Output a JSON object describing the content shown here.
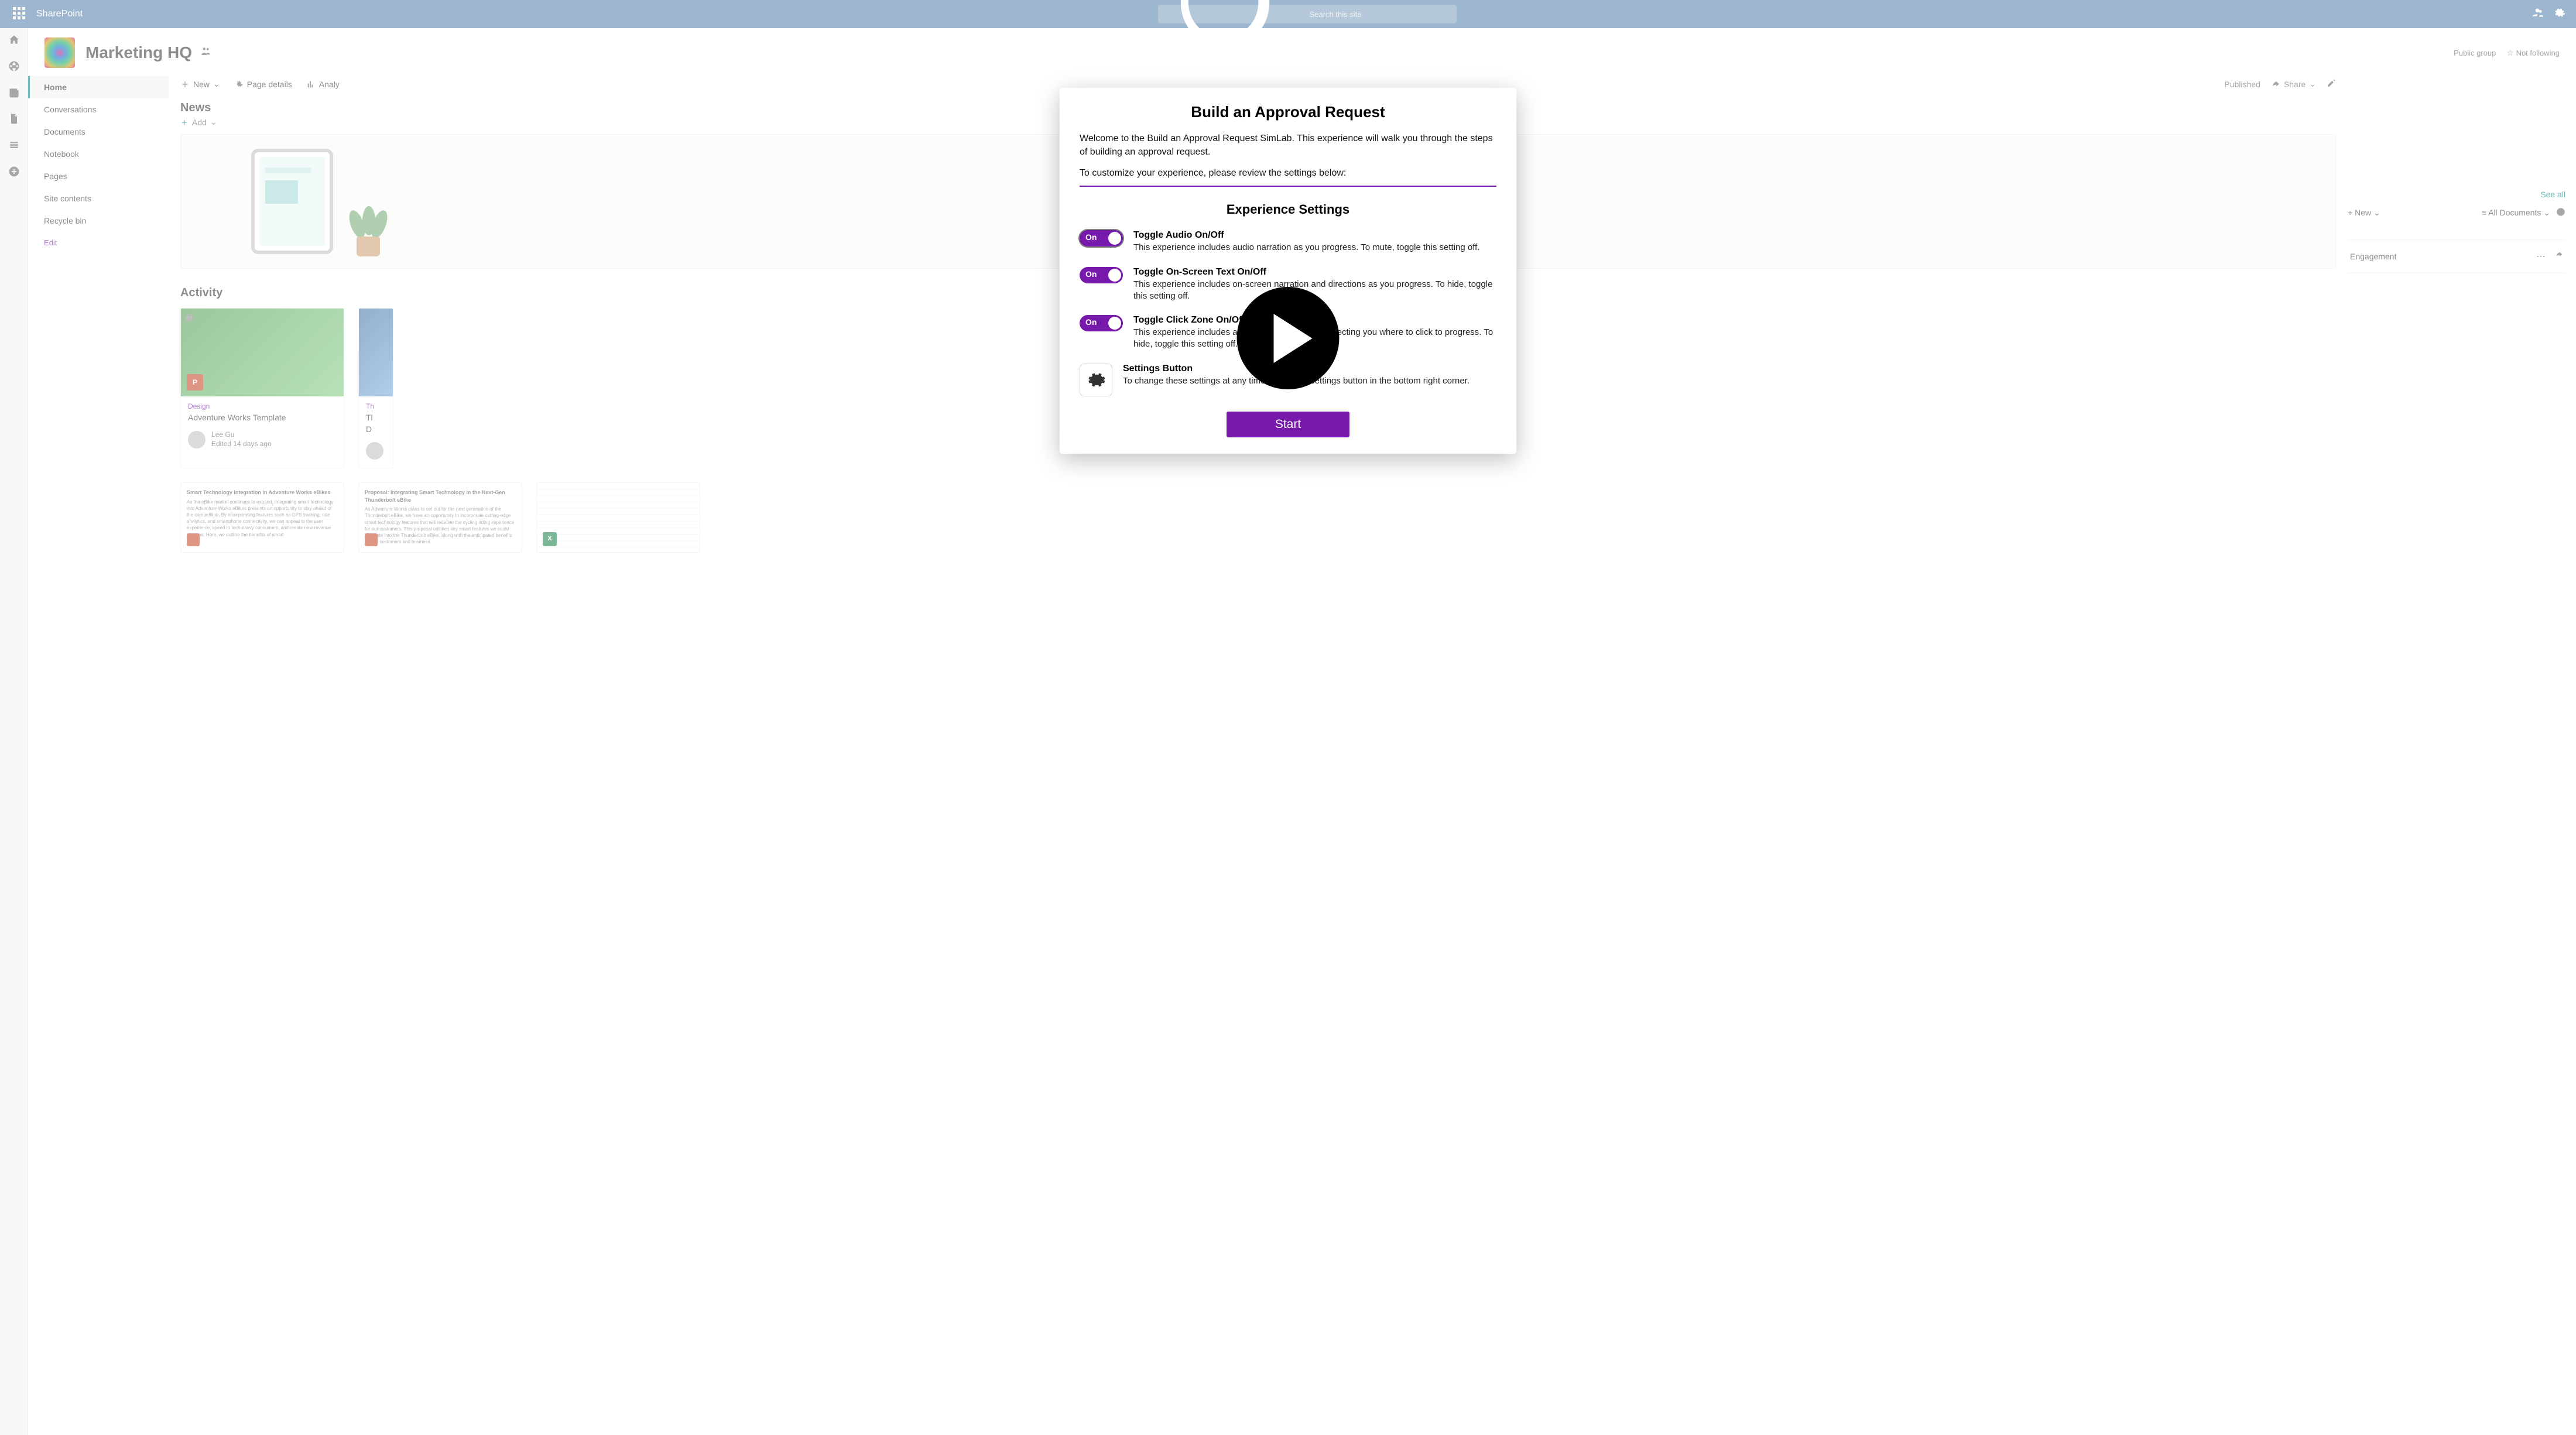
{
  "topbar": {
    "app_name": "SharePoint",
    "search_placeholder": "Search this site"
  },
  "site": {
    "title": "Marketing HQ",
    "group_type": "Public group",
    "follow_label": "Not following"
  },
  "sidenav": {
    "items": [
      "Home",
      "Conversations",
      "Documents",
      "Notebook",
      "Pages",
      "Site contents",
      "Recycle bin"
    ],
    "edit": "Edit"
  },
  "cmdbar": {
    "new": "New",
    "page_details": "Page details",
    "analy": "Analy",
    "published": "Published",
    "share": "Share"
  },
  "news": {
    "heading": "News",
    "add": "Add"
  },
  "activity": {
    "heading": "Activity",
    "card1": {
      "category": "Design",
      "title": "Adventure Works Template",
      "author": "Lee Gu",
      "edited": "Edited 14 days ago"
    },
    "card2": {
      "category": "Th",
      "title_a": "Tl",
      "title_b": "D"
    }
  },
  "thumbs": {
    "t1_title": "Smart Technology Integration in Adventure Works eBikes",
    "t1_body": "As the eBike market continues to expand, integrating smart technology into Adventure Works eBikes presents an opportunity to stay ahead of the competition. By incorporating features such as GPS tracking, ride analytics, and smartphone connectivity, we can appeal to the user experience, speed to tech-savvy consumers, and create new revenue streams. Here, we outline the benefits of smart",
    "t2_title": "Proposal: Integrating Smart Technology in the Next-Gen Thunderbolt eBike",
    "t2_body": "As Adventure Works plans to set out for the next generation of the Thunderbolt eBike, we have an opportunity to incorporate cutting-edge smart technology features that will redefine the cycling riding experience for our customers. This proposal outlines key smart features we could integrate into the Thunderbolt eBike, along with the anticipated benefits for our customers and business."
  },
  "rightcol": {
    "seeall": "See all",
    "engagement": "Engagement",
    "alldocs": "All Documents",
    "plus_new": "New"
  },
  "modal": {
    "title": "Build an Approval Request",
    "intro": "Welcome to the Build an Approval Request SimLab. This experience will walk you through the steps of building an approval request.",
    "intro2": "To customize your experience, please review the settings below:",
    "subhead": "Experience Settings",
    "s1_title": "Toggle Audio On/Off",
    "s1_body": "This experience includes audio narration as you progress. To mute, toggle this setting off.",
    "s2_title": "Toggle On-Screen Text On/Off",
    "s2_body": "This experience includes on-screen narration and directions as you progress. To hide, toggle this setting off.",
    "s3_title": "Toggle Click Zone On/Off",
    "s3_body": "This experience includes an on-screen click zone directing you where to click to progress. To hide, toggle this setting off.",
    "s4_title": "Settings Button",
    "s4_body": "To change these settings at any time, select the settings button in the bottom right corner.",
    "toggle_on": "On",
    "start": "Start"
  }
}
